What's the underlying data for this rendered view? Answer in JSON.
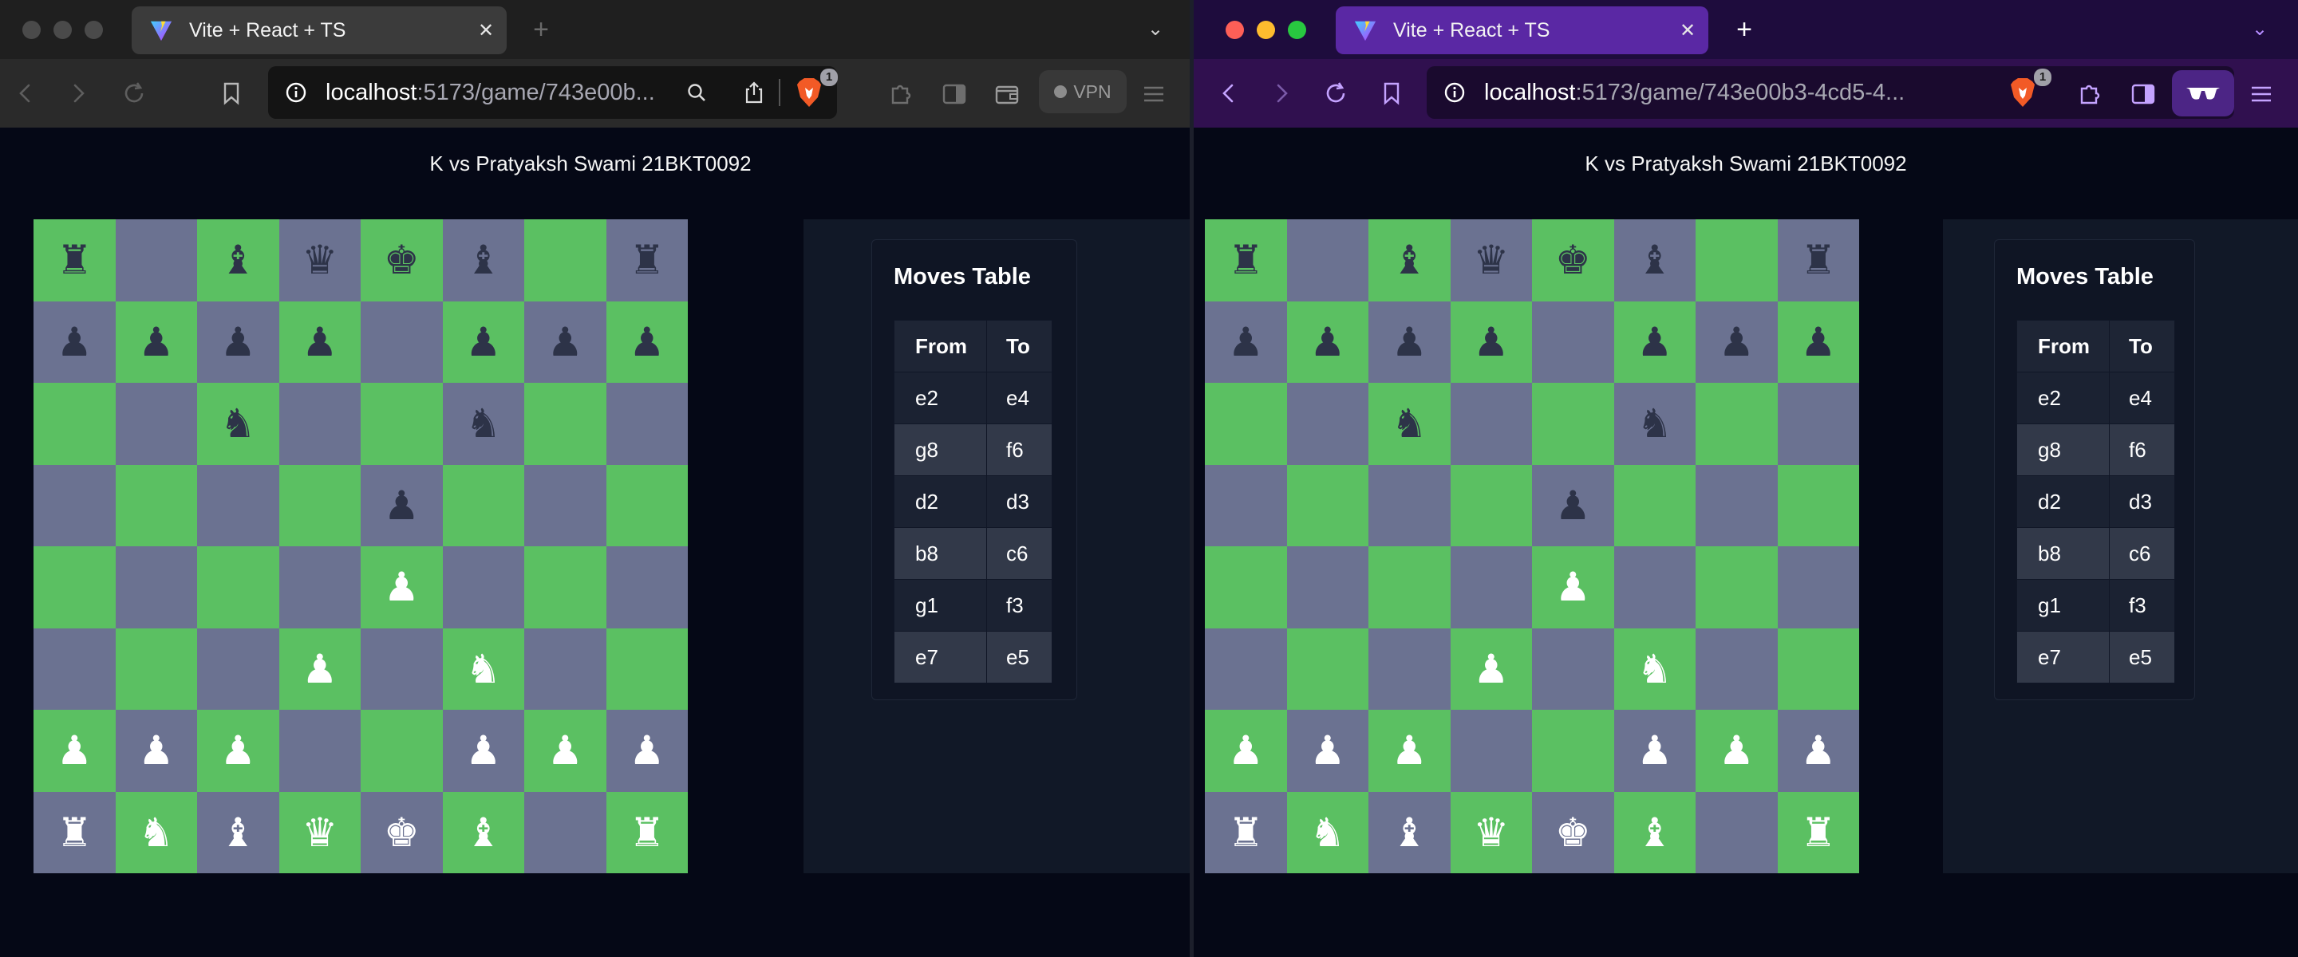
{
  "left_window": {
    "tab_title": "Vite + React + TS",
    "url_host": "localhost",
    "url_path": ":5173/game/743e00b...",
    "vpn_label": "VPN",
    "shields_badge": "1"
  },
  "right_window": {
    "tab_title": "Vite + React + TS",
    "url_host": "localhost",
    "url_path": ":5173/game/743e00b3-4cd5-4...",
    "shields_badge": "1"
  },
  "game": {
    "heading": "K vs Pratyaksh Swami 21BKT0092",
    "moves_title": "Moves Table",
    "moves_headers": [
      "From",
      "To"
    ],
    "moves": [
      {
        "from": "e2",
        "to": "e4"
      },
      {
        "from": "g8",
        "to": "f6"
      },
      {
        "from": "d2",
        "to": "d3"
      },
      {
        "from": "b8",
        "to": "c6"
      },
      {
        "from": "g1",
        "to": "f3"
      },
      {
        "from": "e7",
        "to": "e5"
      }
    ],
    "board": [
      [
        "bR",
        "",
        "bB",
        "bQ",
        "bK",
        "bB",
        "",
        "bR"
      ],
      [
        "bP",
        "bP",
        "bP",
        "bP",
        "",
        "bP",
        "bP",
        "bP"
      ],
      [
        "",
        "",
        "bN",
        "",
        "",
        "bN",
        "",
        ""
      ],
      [
        "",
        "",
        "",
        "",
        "bP",
        "",
        "",
        ""
      ],
      [
        "",
        "",
        "",
        "",
        "wP",
        "",
        "",
        ""
      ],
      [
        "",
        "",
        "",
        "wP",
        "",
        "wN",
        "",
        ""
      ],
      [
        "wP",
        "wP",
        "wP",
        "",
        "",
        "wP",
        "wP",
        "wP"
      ],
      [
        "wR",
        "wN",
        "wB",
        "wQ",
        "wK",
        "wB",
        "",
        "wR"
      ]
    ]
  },
  "colors": {
    "light_square": "#5bc062",
    "dark_square": "#6b7291",
    "black_piece": "#2d3348",
    "white_piece": "#ffffff"
  }
}
